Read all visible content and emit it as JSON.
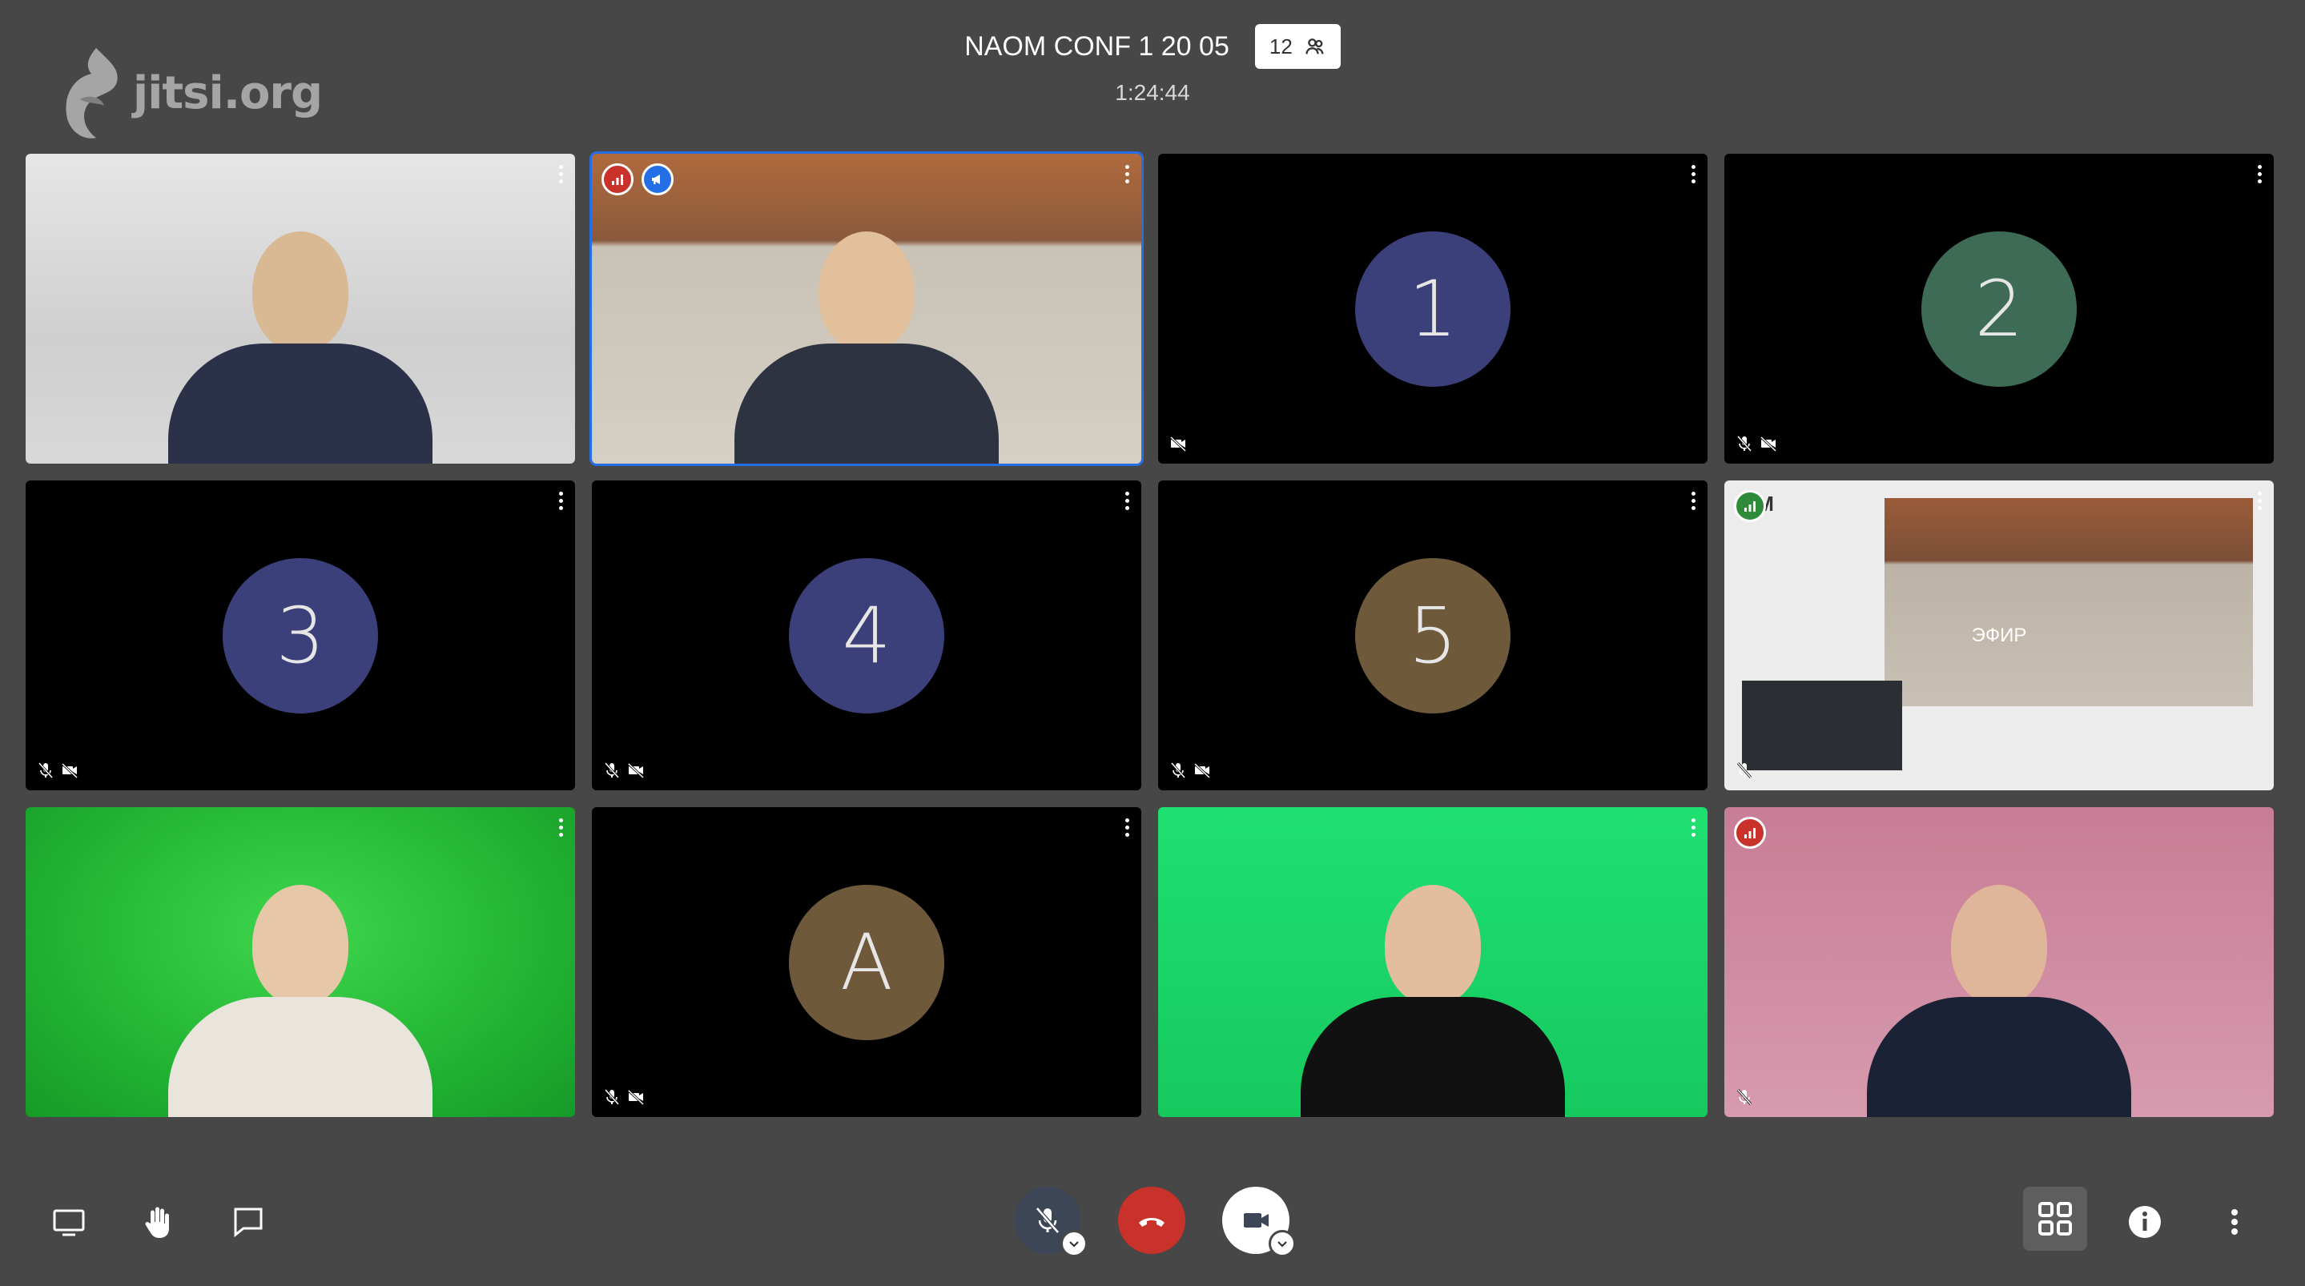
{
  "brand": {
    "logo_text": "jitsi.org"
  },
  "header": {
    "conference_title": "NAOM CONF 1 20 05",
    "participant_count": "12",
    "duration": "1:24:44"
  },
  "tiles": [
    {
      "type": "video",
      "name": "participant-1"
    },
    {
      "type": "video",
      "name": "participant-2-dominant-speaker"
    },
    {
      "type": "avatar",
      "initial": "1",
      "color": "#3b3f7a"
    },
    {
      "type": "avatar",
      "initial": "2",
      "color": "#3e6b55"
    },
    {
      "type": "avatar",
      "initial": "3",
      "color": "#3b3f7a"
    },
    {
      "type": "avatar",
      "initial": "4",
      "color": "#3b3f7a"
    },
    {
      "type": "avatar",
      "initial": "5",
      "color": "#6e5a3a"
    },
    {
      "type": "video",
      "name": "participant-broadcast",
      "overlay_text": "ЭФИР",
      "logo_text": "OM"
    },
    {
      "type": "video",
      "name": "participant-greenscreen-1"
    },
    {
      "type": "avatar",
      "initial": "A",
      "color": "#6e5a3a"
    },
    {
      "type": "video",
      "name": "participant-greenscreen-2"
    },
    {
      "type": "video",
      "name": "participant-pink-bg"
    }
  ],
  "colors": {
    "background": "#474747",
    "active_border": "#246fe5",
    "hangup": "#c8322b",
    "connection_bad": "#c8322b",
    "connection_good": "#2e8b3a",
    "moderator": "#246fe5"
  },
  "toolbar": {
    "left": [
      "screen-share-icon",
      "raise-hand-icon",
      "chat-icon"
    ],
    "center": [
      "microphone-muted-icon",
      "hangup-icon",
      "camera-icon"
    ],
    "right": [
      "tile-view-icon",
      "info-icon",
      "more-options-icon"
    ]
  }
}
